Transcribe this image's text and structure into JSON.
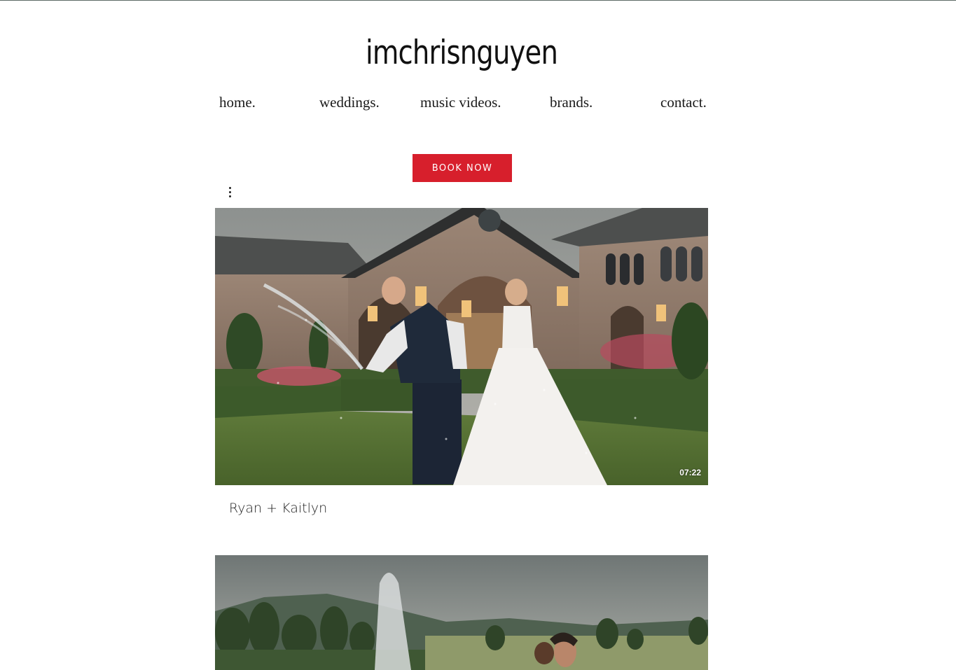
{
  "site": {
    "title": "imchrisnguyen"
  },
  "nav": {
    "items": [
      {
        "label": "home."
      },
      {
        "label": "weddings."
      },
      {
        "label": "music videos."
      },
      {
        "label": "brands."
      },
      {
        "label": "contact."
      }
    ]
  },
  "cta": {
    "book_label": "BOOK NOW",
    "color": "#d71f2c"
  },
  "gallery": {
    "more_icon": "more-vertical-icon",
    "videos": [
      {
        "title": "Ryan + Kaitlyn",
        "duration": "07:22"
      },
      {
        "title": "",
        "duration": ""
      }
    ]
  }
}
